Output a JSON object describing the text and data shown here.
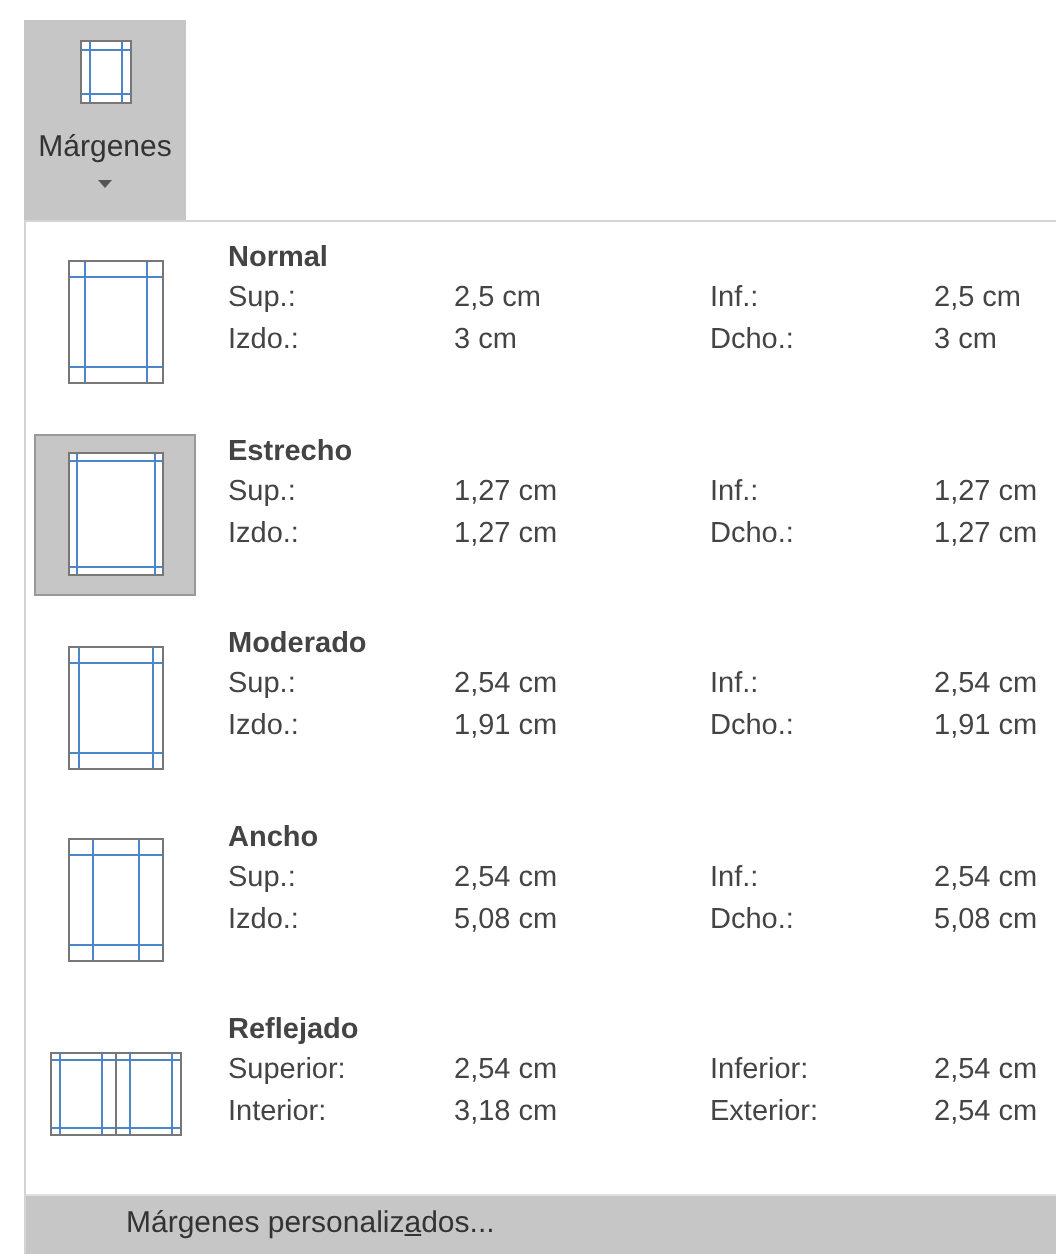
{
  "ribbon_button": {
    "label": "Márgenes",
    "selected": true
  },
  "presets": [
    {
      "kind": "normal",
      "name": "Normal",
      "selected": false,
      "rows": [
        [
          "Sup.:",
          "2,5 cm",
          "Inf.:",
          "2,5 cm"
        ],
        [
          "Izdo.:",
          "3 cm",
          "Dcho.:",
          "3 cm"
        ]
      ]
    },
    {
      "kind": "narrow",
      "name": "Estrecho",
      "selected": true,
      "rows": [
        [
          "Sup.:",
          "1,27 cm",
          "Inf.:",
          "1,27 cm"
        ],
        [
          "Izdo.:",
          "1,27 cm",
          "Dcho.:",
          "1,27 cm"
        ]
      ]
    },
    {
      "kind": "moderate",
      "name": "Moderado",
      "selected": false,
      "rows": [
        [
          "Sup.:",
          "2,54 cm",
          "Inf.:",
          "2,54 cm"
        ],
        [
          "Izdo.:",
          "1,91 cm",
          "Dcho.:",
          "1,91 cm"
        ]
      ]
    },
    {
      "kind": "wide",
      "name": "Ancho",
      "selected": false,
      "rows": [
        [
          "Sup.:",
          "2,54 cm",
          "Inf.:",
          "2,54 cm"
        ],
        [
          "Izdo.:",
          "5,08 cm",
          "Dcho.:",
          "5,08 cm"
        ]
      ]
    },
    {
      "kind": "mirrored",
      "name": "Reflejado",
      "selected": false,
      "rows": [
        [
          "Superior:",
          "2,54 cm",
          "Inferior:",
          "2,54 cm"
        ],
        [
          "Interior:",
          "3,18 cm",
          "Exterior:",
          "2,54 cm"
        ]
      ]
    }
  ],
  "footer": {
    "before": "Márgenes personaliz",
    "access_key": "a",
    "after": "dos...",
    "selected": true
  }
}
